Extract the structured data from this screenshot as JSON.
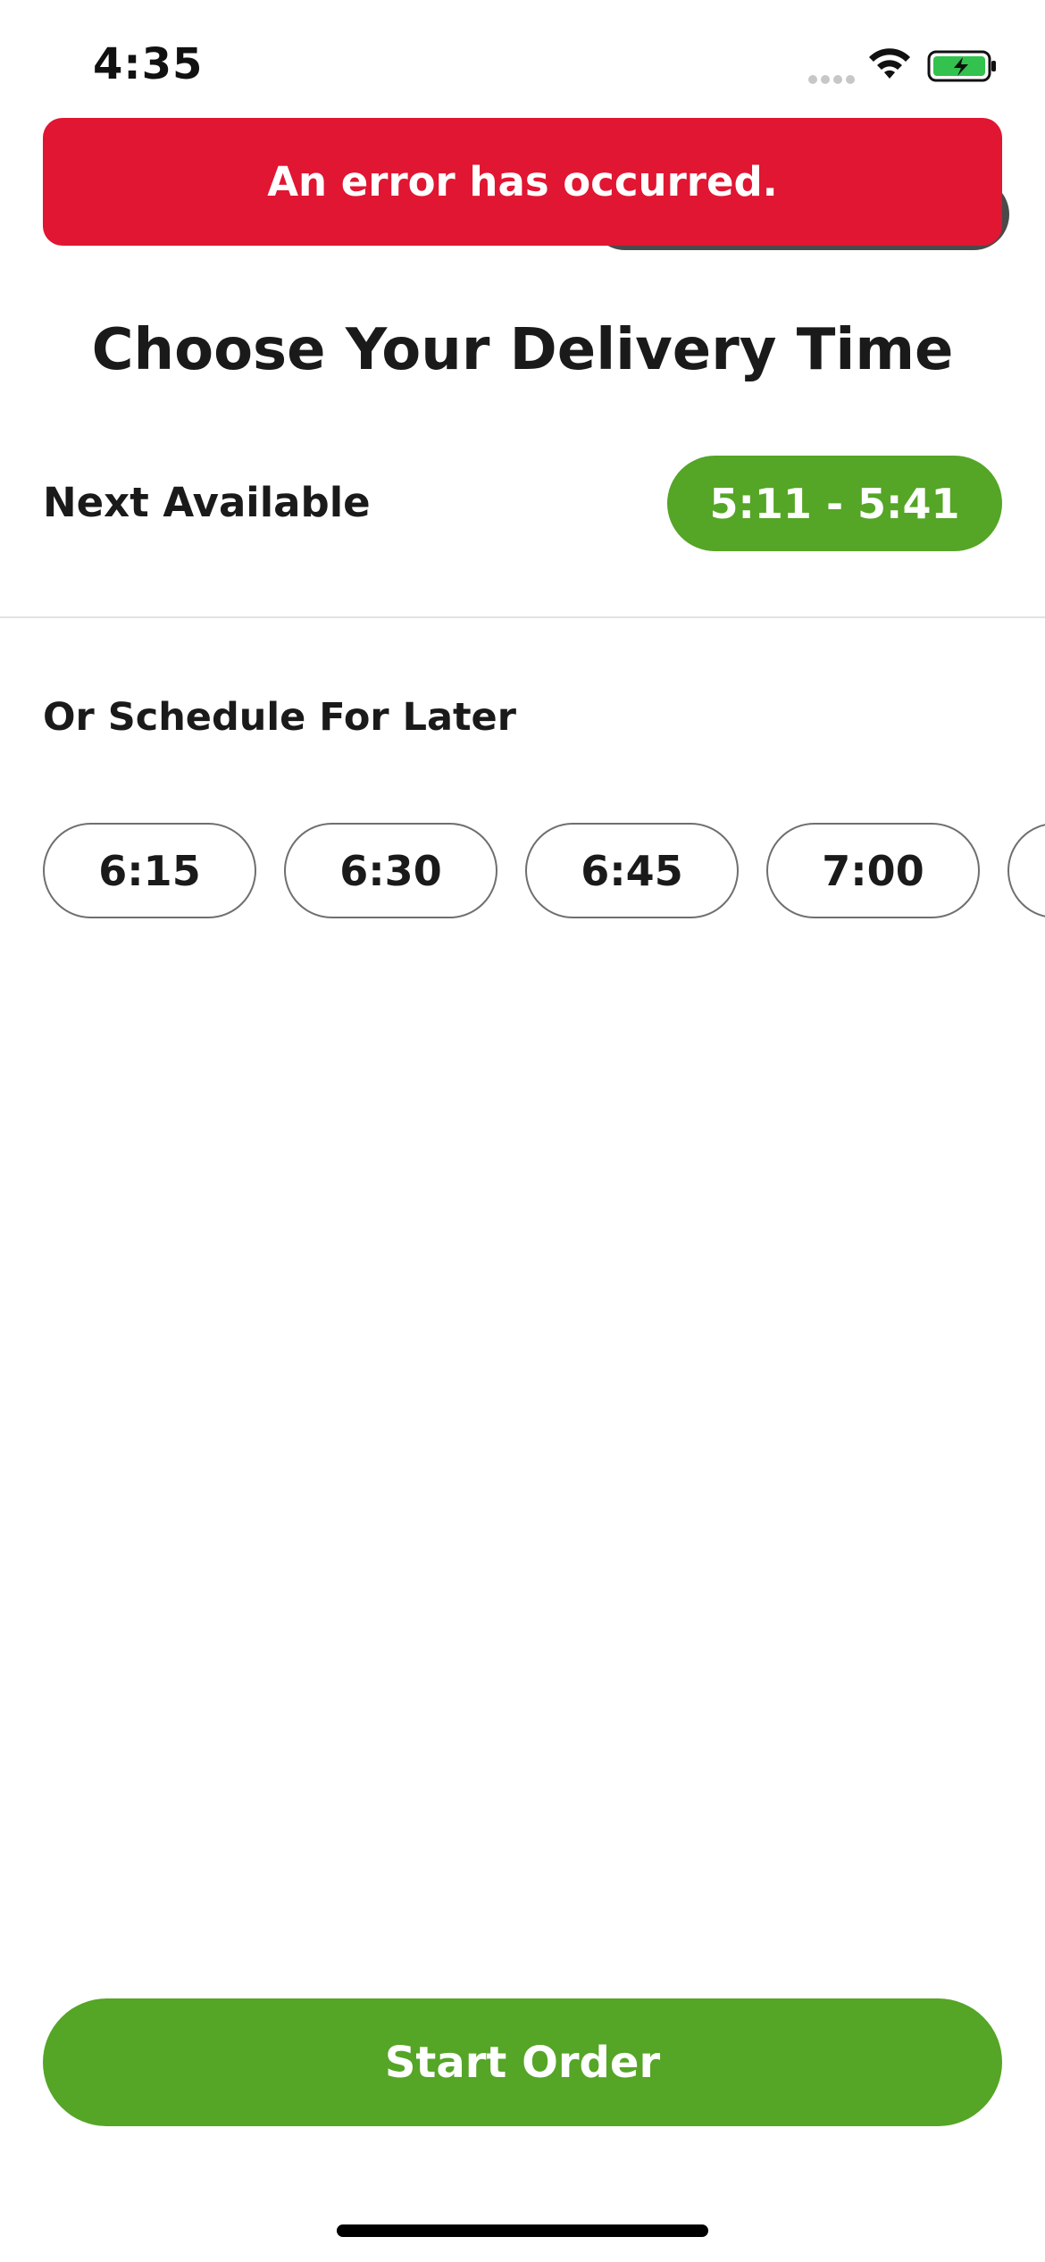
{
  "status_bar": {
    "time": "4:35",
    "icons": [
      "signal-dots-icon",
      "wifi-icon",
      "battery-charging-icon"
    ]
  },
  "error_banner": {
    "message": "An error has occurred.",
    "color": "#e01632"
  },
  "title": "Choose Your Delivery Time",
  "next_available": {
    "label": "Next Available",
    "time_range": "5:11 - 5:41"
  },
  "schedule": {
    "label": "Or Schedule For Later",
    "slots": [
      "6:15",
      "6:30",
      "6:45",
      "7:00"
    ]
  },
  "start_order": {
    "label": "Start Order"
  },
  "colors": {
    "accent_green": "#55a526",
    "error_red": "#e01632",
    "text": "#1a1a1a"
  }
}
